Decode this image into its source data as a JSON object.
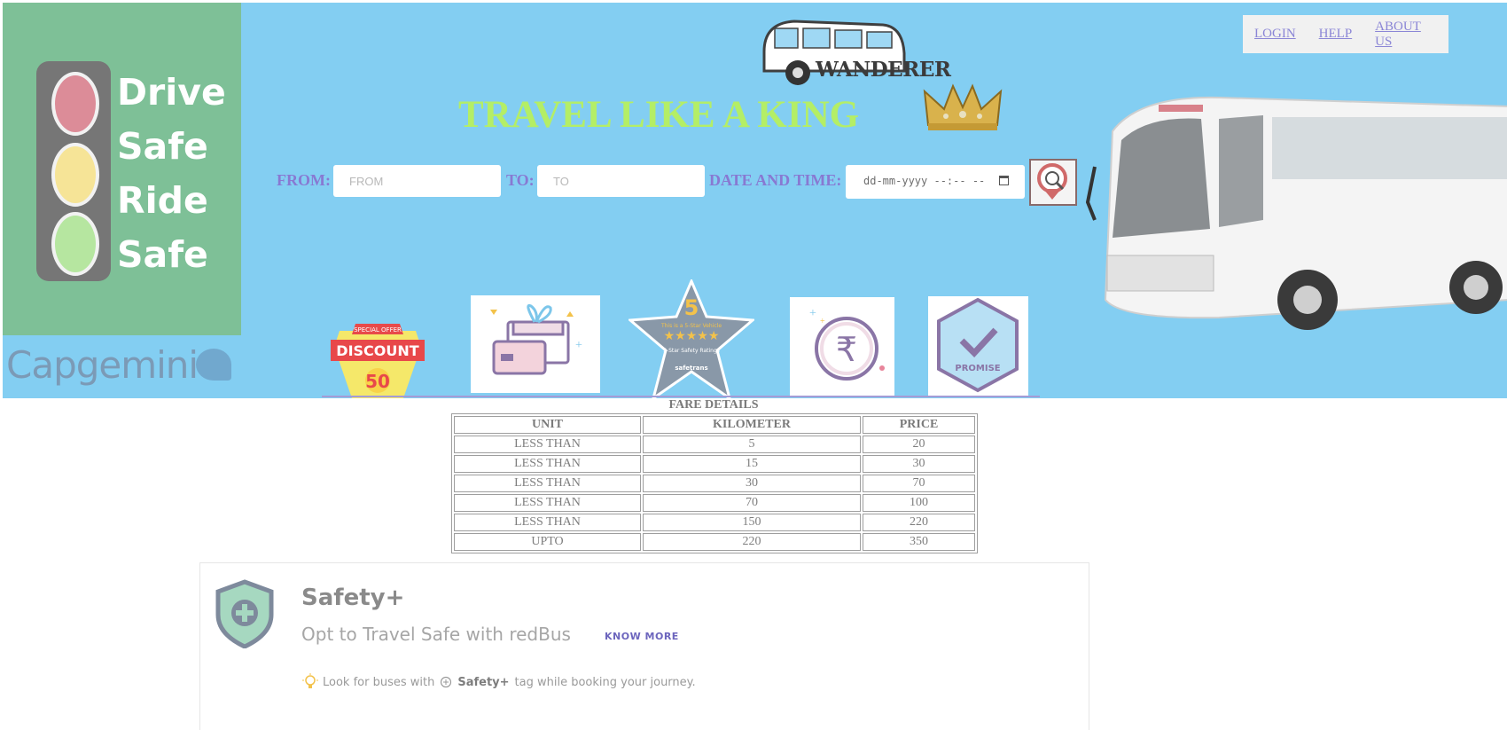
{
  "left_banner": {
    "lines": [
      "Drive",
      "Safe",
      "Ride",
      "Safe"
    ],
    "sponsor": "Capgemini"
  },
  "nav": {
    "items": [
      {
        "label": "LOGIN"
      },
      {
        "label": "HELP"
      },
      {
        "label": "ABOUT US"
      }
    ]
  },
  "logo": {
    "text": "WANDERER"
  },
  "tagline": "TRAVEL LIKE A KING",
  "search": {
    "from_label": "FROM:",
    "from_placeholder": "FROM",
    "to_label": "TO:",
    "to_placeholder": "TO",
    "date_label": "DATE AND TIME:",
    "date_value": "dd-mm-yyyy --:-- --"
  },
  "offers": {
    "discount": {
      "line1": "SPECIAL OFFER",
      "line2": "DISCOUNT",
      "line3": "50"
    },
    "star": {
      "number": "5",
      "line1": "This is a 5-Star Vehicle",
      "line2": "5-Star Safety Ratings",
      "line3": "safetrans"
    },
    "promise": {
      "text": "PROMISE"
    },
    "rupee": {
      "symbol": "₹"
    }
  },
  "fare": {
    "title": "FARE DETAILS",
    "headers": [
      "UNIT",
      "KILOMETER",
      "PRICE"
    ],
    "rows": [
      [
        "LESS THAN",
        "5",
        "20"
      ],
      [
        "LESS THAN",
        "15",
        "30"
      ],
      [
        "LESS THAN",
        "30",
        "70"
      ],
      [
        "LESS THAN",
        "70",
        "100"
      ],
      [
        "LESS THAN",
        "150",
        "220"
      ],
      [
        "UPTO",
        "220",
        "350"
      ]
    ]
  },
  "safety": {
    "title": "Safety+",
    "subtitle": "Opt to Travel Safe with redBus",
    "know_more": "KNOW MORE",
    "tip_before": "Look for buses with",
    "tip_tag": "Safety+",
    "tip_after": "tag while booking your journey."
  },
  "colors": {
    "hero_bg": "#83cef2",
    "drive_panel": "#7ec097",
    "tagline": "#b4ee66",
    "label": "#8879d2",
    "link": "#8b86d6"
  }
}
